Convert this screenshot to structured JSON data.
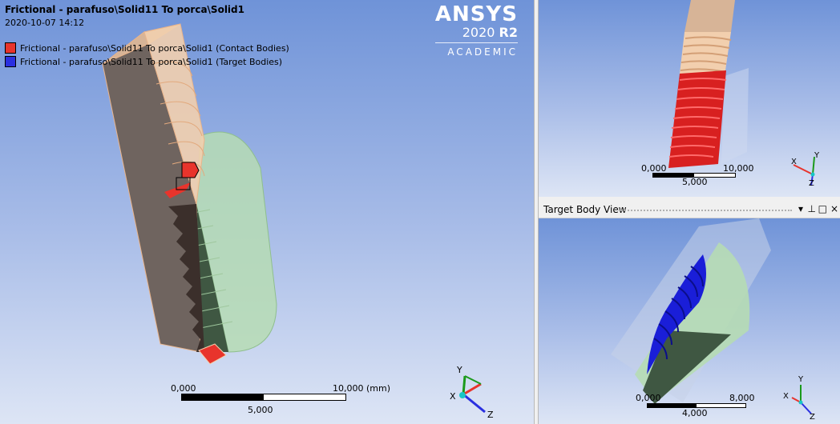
{
  "main_view": {
    "title": "Frictional - parafuso\\Solid11 To porca\\Solid1",
    "date": "2020-10-07 14:12",
    "legend": [
      {
        "label": "Frictional - parafuso\\Solid11 To porca\\Solid1 (Contact Bodies)",
        "color": "#e8342c"
      },
      {
        "label": "Frictional - parafuso\\Solid11 To porca\\Solid1 (Target Bodies)",
        "color": "#2a2fe0"
      }
    ],
    "logo": {
      "name": "ANSYS",
      "version_year": "2020",
      "version_rel": "R2",
      "edition": "ACADEMIC"
    },
    "scale": {
      "left": "0,000",
      "right": "10,000 (mm)",
      "mid": "5,000"
    },
    "triad": {
      "x": "X",
      "y": "Y",
      "z": "Z"
    }
  },
  "contact_view": {
    "scale": {
      "left": "0,000",
      "right": "10,000",
      "mid": "5,000"
    },
    "triad": {
      "x": "X",
      "y": "Y",
      "z": "Z"
    }
  },
  "target_view": {
    "title": "Target Body View",
    "buttons": {
      "dropdown": "▾",
      "pin": "⊥",
      "restore": "□",
      "close": "×"
    },
    "scale": {
      "left": "0,000",
      "right": "8,000",
      "mid": "4,000"
    },
    "triad": {
      "x": "X",
      "y": "Y",
      "z": "Z"
    }
  }
}
